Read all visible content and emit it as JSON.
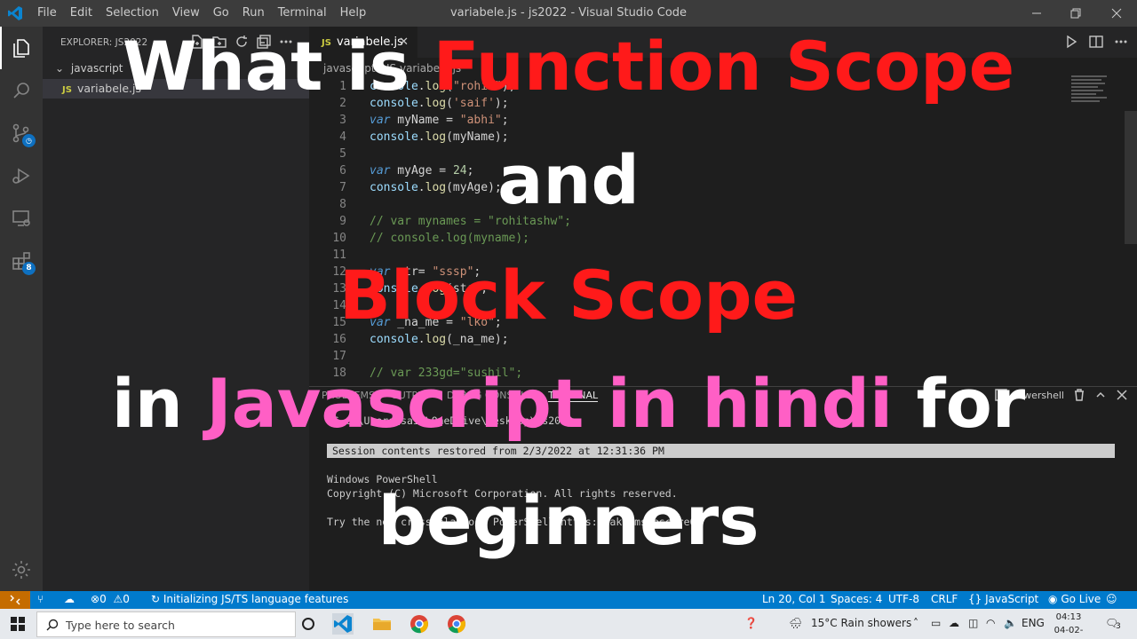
{
  "window": {
    "title": "variabele.js - js2022 - Visual Studio Code",
    "menu": [
      "File",
      "Edit",
      "Selection",
      "View",
      "Go",
      "Run",
      "Terminal",
      "Help"
    ]
  },
  "activity_bar": {
    "items": [
      "explorer-icon",
      "search-icon",
      "source-control-icon",
      "run-debug-icon",
      "remote-explorer-icon",
      "extensions-icon"
    ],
    "extensions_badge": "8",
    "bottom": "gear-icon"
  },
  "sidebar": {
    "header": "EXPLORER: JS2022",
    "folder": "javascript",
    "file_label": "variabele.js"
  },
  "editor": {
    "tab_label": "variabele.js",
    "breadcrumb": "javascript › JS variabele.js",
    "lines": [
      {
        "n": "1",
        "t": "console.log(\"rohit\");"
      },
      {
        "n": "2",
        "t": "console.log('saif');"
      },
      {
        "n": "3",
        "t": "var myName = \"abhi\";"
      },
      {
        "n": "4",
        "t": "console.log(myName);"
      },
      {
        "n": "5",
        "t": ""
      },
      {
        "n": "6",
        "t": "var myAge = 24;"
      },
      {
        "n": "7",
        "t": "console.log(myAge);"
      },
      {
        "n": "8",
        "t": ""
      },
      {
        "n": "9",
        "t": "// var mynames = \"rohitashw\";"
      },
      {
        "n": "10",
        "t": "// console.log(myname);"
      },
      {
        "n": "11",
        "t": ""
      },
      {
        "n": "12",
        "t": "var str= \"sssp\";"
      },
      {
        "n": "13",
        "t": "console.log(str);"
      },
      {
        "n": "14",
        "t": ""
      },
      {
        "n": "15",
        "t": "var _na_me = \"lko\";"
      },
      {
        "n": "16",
        "t": "console.log(_na_me);"
      },
      {
        "n": "17",
        "t": ""
      },
      {
        "n": "18",
        "t": "// var 233gd=\"sushil\";"
      }
    ]
  },
  "panel": {
    "tabs": [
      "PROBLEMS",
      "OUTPUT",
      "DEBUG CONSOLE",
      "TERMINAL"
    ],
    "active_tab": "TERMINAL",
    "shell": "powershell",
    "terminal_lines": [
      "PS C:\\Users\\saif\\OneDrive\\Desktop\\js2022>",
      "",
      "Session contents restored from 2/3/2022 at 12:31:36 PM",
      "",
      "Windows PowerShell",
      "Copyright (C) Microsoft Corporation. All rights reserved.",
      "",
      "Try the new cross-platform PowerShell https://aka.ms/pscore6"
    ]
  },
  "statusbar": {
    "errors": "0",
    "warnings": "0",
    "task": "Initializing JS/TS language features",
    "position": "Ln 20, Col 1",
    "spaces": "Spaces: 4",
    "encoding": "UTF-8",
    "eol": "CRLF",
    "language": "JavaScript",
    "golive": "Go Live"
  },
  "taskbar": {
    "search_placeholder": "Type here to search",
    "weather": "15°C  Rain showers",
    "lang": "ENG",
    "time": "04:13",
    "date": "04-02-2022",
    "notif": "3"
  },
  "overlay": {
    "line1_a": "What is ",
    "line1_b": "Function Scope",
    "line2": "and",
    "line3": "Block Scope",
    "line4_a": "in ",
    "line4_b": "Javascript in hindi",
    "line4_c": " for",
    "line5": "beginners"
  },
  "colors": {
    "overlay_white": "#ffffff",
    "overlay_red": "#ff1a1a",
    "overlay_pink": "#ff5fc5",
    "statusbar": "#007acc",
    "remote": "#c56c00"
  }
}
